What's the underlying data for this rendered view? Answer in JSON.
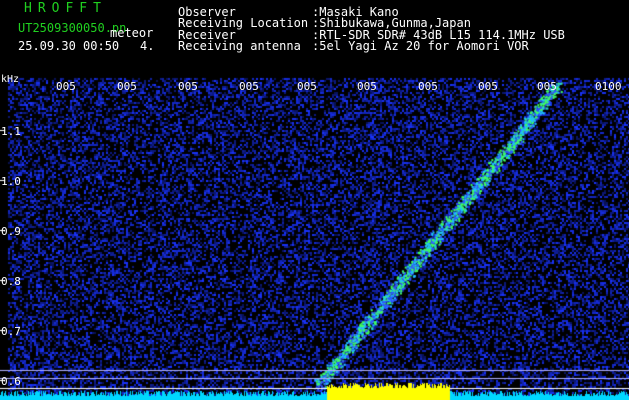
{
  "header": {
    "logo": "HROFFT",
    "file_name": "UT2509300050.pn",
    "meteor_tag": "meteor",
    "date_time": "25.09.30 00:50",
    "count": "4.",
    "observer_label": "Observer",
    "observer_value": ":Masaki Kano",
    "location_label": "Receiving Location",
    "location_value": ":Shibukawa,Gunma,Japan",
    "receiver_label": "Receiver",
    "receiver_value": ":RTL-SDR SDR# 43dB L15 114.1MHz USB",
    "antenna_label": "Receiving antenna",
    "antenna_value": ":5el Yagi Az 20 for Aomori VOR"
  },
  "axis": {
    "unit_label": "kHz",
    "time_ticks": [
      "005",
      "005",
      "005",
      "005",
      "005",
      "005",
      "005",
      "005",
      "005",
      "0100"
    ],
    "freq_ticks": [
      "1.1",
      "1.0",
      "0.9",
      "0.8",
      "0.7",
      "0.6"
    ]
  },
  "colors": {
    "background": "#000000",
    "noise_blue": "#1a2fff",
    "trail_green": "#40ff60",
    "cyan_baseline": "#00d8ff",
    "yellow_burst": "#ffff00",
    "header_green": "#20d020"
  }
}
